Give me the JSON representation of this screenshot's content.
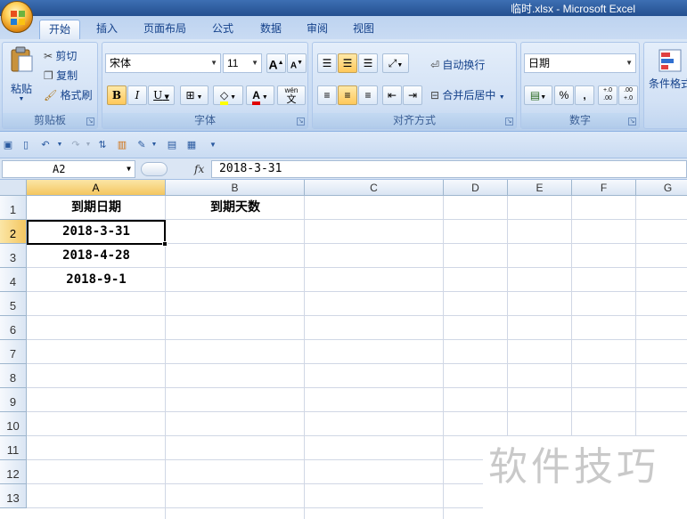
{
  "title": "临时.xlsx - Microsoft Excel",
  "tabs": [
    "开始",
    "插入",
    "页面布局",
    "公式",
    "数据",
    "审阅",
    "视图"
  ],
  "active_tab": "开始",
  "clipboard": {
    "paste": "粘贴",
    "cut": "剪切",
    "copy": "复制",
    "format_painter": "格式刷",
    "label": "剪贴板"
  },
  "font": {
    "name": "宋体",
    "size": "11",
    "grow": "A",
    "shrink": "A",
    "bold": "B",
    "italic": "I",
    "underline": "U",
    "color_letter": "A",
    "phonetic": "wén",
    "phonetic_char": "文",
    "label": "字体"
  },
  "alignment": {
    "wrap": "自动换行",
    "merge": "合并后居中",
    "label": "对齐方式"
  },
  "number": {
    "format": "日期",
    "percent": "%",
    "comma": ",",
    "inc_decimal": "+.0 .00",
    "dec_decimal": ".00 +.0",
    "label": "数字"
  },
  "styles": {
    "conditional": "条件格式"
  },
  "name_box": "A2",
  "fx": "fx",
  "formula": "2018-3-31",
  "columns": [
    "A",
    "B",
    "C",
    "D",
    "E",
    "F",
    "G"
  ],
  "rows": [
    "1",
    "2",
    "3",
    "4",
    "5",
    "6",
    "7",
    "8",
    "9",
    "10",
    "11",
    "12",
    "13"
  ],
  "cells": {
    "A1": "到期日期",
    "B1": "到期天数",
    "A2": "2018-3-31",
    "A3": "2018-4-28",
    "A4": "2018-9-1"
  },
  "watermark": "软件技巧",
  "colors": {
    "selection_header": "#f4c660",
    "ribbon": "#c4d8f1",
    "grid_line": "#d0d7e5"
  }
}
